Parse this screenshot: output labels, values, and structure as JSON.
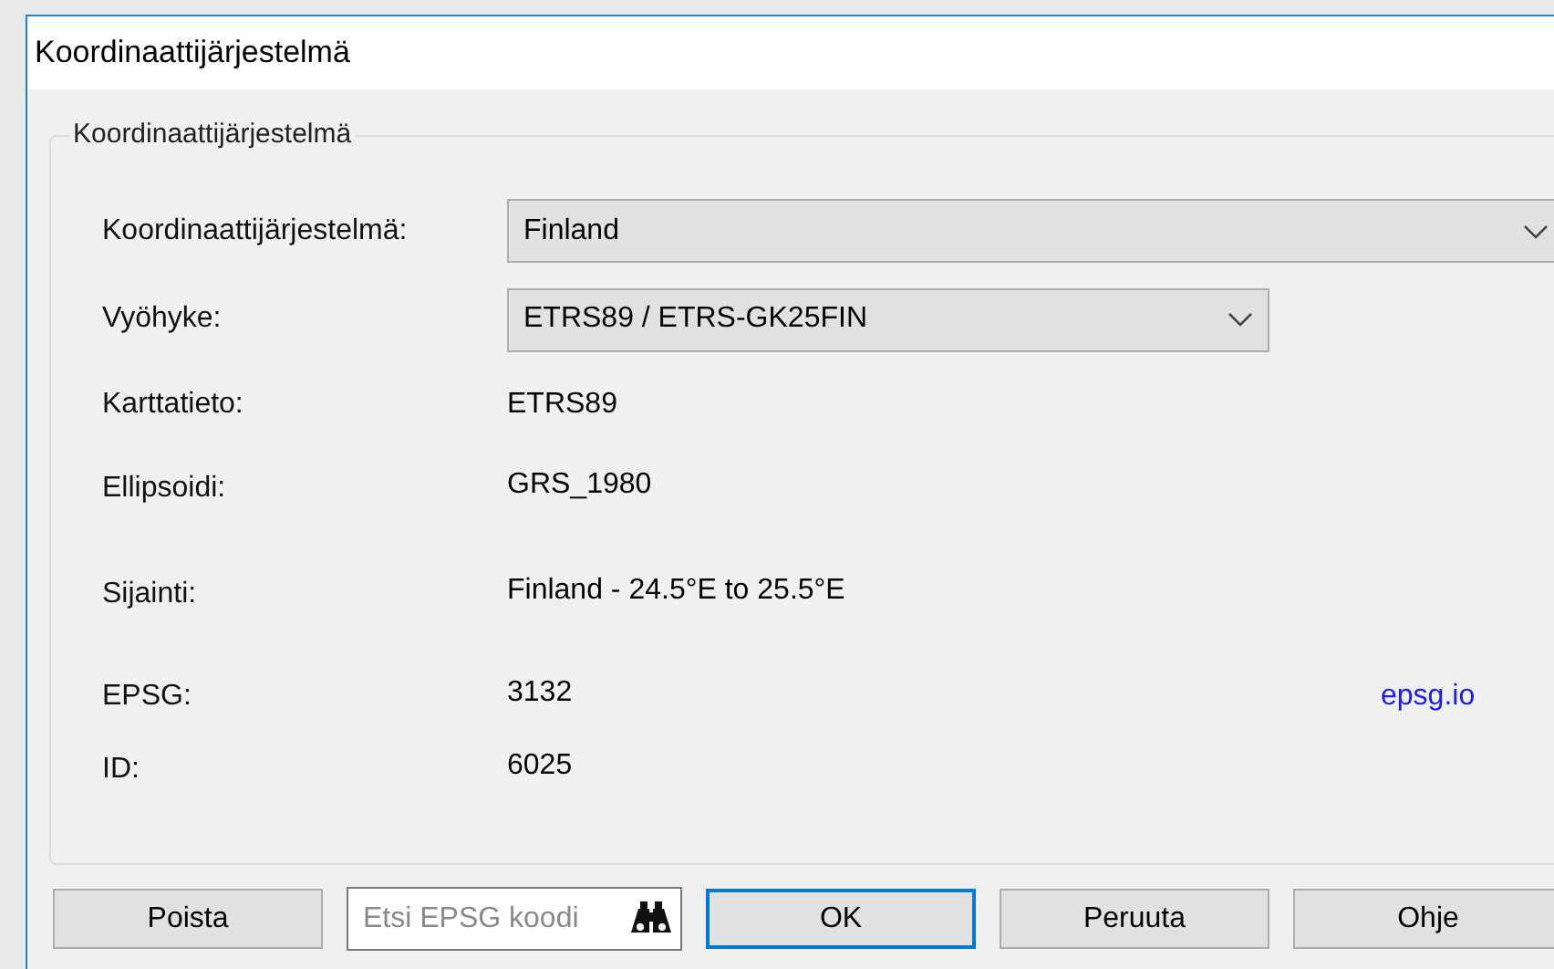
{
  "window": {
    "title": "Koordinaattijärjestelmä"
  },
  "group": {
    "title": "Koordinaattijärjestelmä",
    "rows": [
      {
        "kind": "combo",
        "label": "Koordinaattijärjestelmä:",
        "value": "Finland",
        "wide": true
      },
      {
        "kind": "combo",
        "label": "Vyöhyke:",
        "value": "ETRS89 / ETRS-GK25FIN",
        "wide": false
      },
      {
        "kind": "text",
        "label": "Karttatieto:",
        "value": "ETRS89"
      },
      {
        "kind": "text",
        "label": "Ellipsoidi:",
        "value": "GRS_1980"
      },
      {
        "kind": "text",
        "label": "Sijainti:",
        "value": "Finland - 24.5°E to 25.5°E"
      },
      {
        "kind": "text",
        "label": "EPSG:",
        "value": "3132",
        "link": "epsg.io"
      },
      {
        "kind": "text",
        "label": "ID:",
        "value": "6025"
      }
    ]
  },
  "buttons": [
    {
      "kind": "button",
      "label": "Poista",
      "default": false
    },
    {
      "kind": "search",
      "placeholder": "Etsi EPSG koodi"
    },
    {
      "kind": "button",
      "label": "OK",
      "default": true
    },
    {
      "kind": "button",
      "label": "Peruuta",
      "default": false
    },
    {
      "kind": "button",
      "label": "Ohje",
      "default": false
    }
  ]
}
